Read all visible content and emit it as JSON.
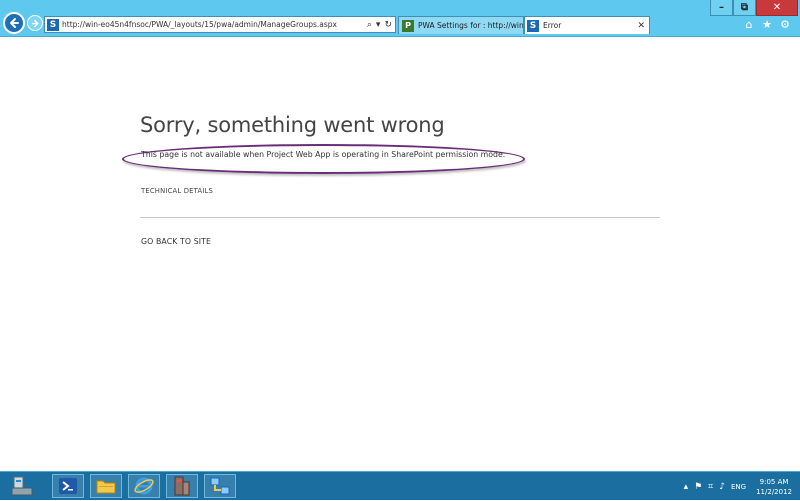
{
  "window": {
    "minimize_glyph": "–",
    "maximize_glyph": "⧉",
    "close_glyph": "✕"
  },
  "browser": {
    "address_url": "http://win-eo45n4fnsoc/PWA/_layouts/15/pwa/admin/ManageGroups.aspx",
    "address_search_glyph": "⌕",
    "address_dropdown_glyph": "▾",
    "address_refresh_glyph": "↻",
    "tabs": [
      {
        "label": "PWA Settings for : http://win-e...",
        "favicon": "project-icon",
        "active": false
      },
      {
        "label": "Error",
        "favicon": "sharepoint-icon",
        "active": true
      }
    ],
    "tab_close_glyph": "✕",
    "toolbar": {
      "home_glyph": "⌂",
      "favorites_glyph": "★",
      "tools_glyph": "⚙"
    }
  },
  "page": {
    "title": "Sorry, something went wrong",
    "message": "This page is not available when Project Web App is operating in SharePoint permission mode.",
    "technical_details": "TECHNICAL DETAILS",
    "go_back": "GO BACK TO SITE"
  },
  "taskbar": {
    "items": [
      "server-manager-icon",
      "powershell-icon",
      "file-explorer-icon",
      "internet-explorer-icon",
      "sharepoint-management-icon",
      "network-setup-icon"
    ],
    "tray_glyphs": {
      "up_arrow": "▴",
      "flag": "⚑",
      "network": "⌗",
      "volume": "♪"
    },
    "language": "ENG",
    "time": "9:05 AM",
    "date": "11/2/2012"
  },
  "colors": {
    "chrome": "#5fc8ef",
    "taskbar": "#1b6fa0",
    "highlight_oval": "#6b2d7a",
    "close_button": "#c7393a"
  }
}
